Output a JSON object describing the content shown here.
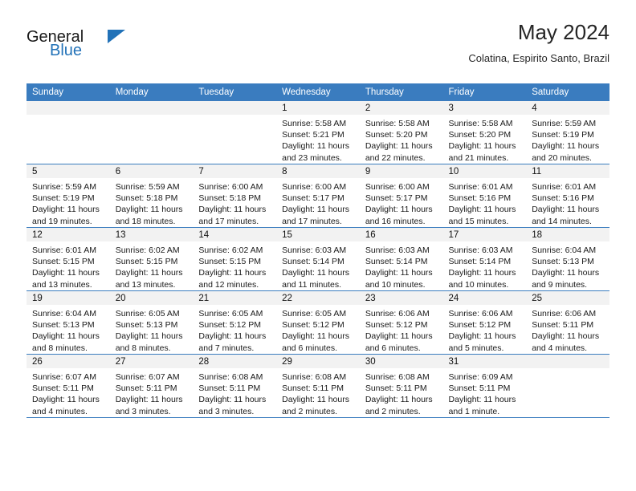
{
  "header": {
    "logo": {
      "word_one": "General",
      "word_two": "Blue",
      "triangle_icon": "triangle-icon",
      "accent_color": "#2272b8"
    },
    "title": "May 2024",
    "subtitle": "Colatina, Espirito Santo, Brazil"
  },
  "calendar": {
    "header_color": "#3a7cbf",
    "weekday_headers": [
      "Sunday",
      "Monday",
      "Tuesday",
      "Wednesday",
      "Thursday",
      "Friday",
      "Saturday"
    ],
    "weeks": [
      [
        {
          "day": "",
          "sunrise": "",
          "sunset": "",
          "daylight_line1": "",
          "daylight_line2": "",
          "empty": true
        },
        {
          "day": "",
          "sunrise": "",
          "sunset": "",
          "daylight_line1": "",
          "daylight_line2": "",
          "empty": true
        },
        {
          "day": "",
          "sunrise": "",
          "sunset": "",
          "daylight_line1": "",
          "daylight_line2": "",
          "empty": true
        },
        {
          "day": "1",
          "sunrise": "Sunrise: 5:58 AM",
          "sunset": "Sunset: 5:21 PM",
          "daylight_line1": "Daylight: 11 hours",
          "daylight_line2": "and 23 minutes."
        },
        {
          "day": "2",
          "sunrise": "Sunrise: 5:58 AM",
          "sunset": "Sunset: 5:20 PM",
          "daylight_line1": "Daylight: 11 hours",
          "daylight_line2": "and 22 minutes."
        },
        {
          "day": "3",
          "sunrise": "Sunrise: 5:58 AM",
          "sunset": "Sunset: 5:20 PM",
          "daylight_line1": "Daylight: 11 hours",
          "daylight_line2": "and 21 minutes."
        },
        {
          "day": "4",
          "sunrise": "Sunrise: 5:59 AM",
          "sunset": "Sunset: 5:19 PM",
          "daylight_line1": "Daylight: 11 hours",
          "daylight_line2": "and 20 minutes."
        }
      ],
      [
        {
          "day": "5",
          "sunrise": "Sunrise: 5:59 AM",
          "sunset": "Sunset: 5:19 PM",
          "daylight_line1": "Daylight: 11 hours",
          "daylight_line2": "and 19 minutes."
        },
        {
          "day": "6",
          "sunrise": "Sunrise: 5:59 AM",
          "sunset": "Sunset: 5:18 PM",
          "daylight_line1": "Daylight: 11 hours",
          "daylight_line2": "and 18 minutes."
        },
        {
          "day": "7",
          "sunrise": "Sunrise: 6:00 AM",
          "sunset": "Sunset: 5:18 PM",
          "daylight_line1": "Daylight: 11 hours",
          "daylight_line2": "and 17 minutes."
        },
        {
          "day": "8",
          "sunrise": "Sunrise: 6:00 AM",
          "sunset": "Sunset: 5:17 PM",
          "daylight_line1": "Daylight: 11 hours",
          "daylight_line2": "and 17 minutes."
        },
        {
          "day": "9",
          "sunrise": "Sunrise: 6:00 AM",
          "sunset": "Sunset: 5:17 PM",
          "daylight_line1": "Daylight: 11 hours",
          "daylight_line2": "and 16 minutes."
        },
        {
          "day": "10",
          "sunrise": "Sunrise: 6:01 AM",
          "sunset": "Sunset: 5:16 PM",
          "daylight_line1": "Daylight: 11 hours",
          "daylight_line2": "and 15 minutes."
        },
        {
          "day": "11",
          "sunrise": "Sunrise: 6:01 AM",
          "sunset": "Sunset: 5:16 PM",
          "daylight_line1": "Daylight: 11 hours",
          "daylight_line2": "and 14 minutes."
        }
      ],
      [
        {
          "day": "12",
          "sunrise": "Sunrise: 6:01 AM",
          "sunset": "Sunset: 5:15 PM",
          "daylight_line1": "Daylight: 11 hours",
          "daylight_line2": "and 13 minutes."
        },
        {
          "day": "13",
          "sunrise": "Sunrise: 6:02 AM",
          "sunset": "Sunset: 5:15 PM",
          "daylight_line1": "Daylight: 11 hours",
          "daylight_line2": "and 13 minutes."
        },
        {
          "day": "14",
          "sunrise": "Sunrise: 6:02 AM",
          "sunset": "Sunset: 5:15 PM",
          "daylight_line1": "Daylight: 11 hours",
          "daylight_line2": "and 12 minutes."
        },
        {
          "day": "15",
          "sunrise": "Sunrise: 6:03 AM",
          "sunset": "Sunset: 5:14 PM",
          "daylight_line1": "Daylight: 11 hours",
          "daylight_line2": "and 11 minutes."
        },
        {
          "day": "16",
          "sunrise": "Sunrise: 6:03 AM",
          "sunset": "Sunset: 5:14 PM",
          "daylight_line1": "Daylight: 11 hours",
          "daylight_line2": "and 10 minutes."
        },
        {
          "day": "17",
          "sunrise": "Sunrise: 6:03 AM",
          "sunset": "Sunset: 5:14 PM",
          "daylight_line1": "Daylight: 11 hours",
          "daylight_line2": "and 10 minutes."
        },
        {
          "day": "18",
          "sunrise": "Sunrise: 6:04 AM",
          "sunset": "Sunset: 5:13 PM",
          "daylight_line1": "Daylight: 11 hours",
          "daylight_line2": "and 9 minutes."
        }
      ],
      [
        {
          "day": "19",
          "sunrise": "Sunrise: 6:04 AM",
          "sunset": "Sunset: 5:13 PM",
          "daylight_line1": "Daylight: 11 hours",
          "daylight_line2": "and 8 minutes."
        },
        {
          "day": "20",
          "sunrise": "Sunrise: 6:05 AM",
          "sunset": "Sunset: 5:13 PM",
          "daylight_line1": "Daylight: 11 hours",
          "daylight_line2": "and 8 minutes."
        },
        {
          "day": "21",
          "sunrise": "Sunrise: 6:05 AM",
          "sunset": "Sunset: 5:12 PM",
          "daylight_line1": "Daylight: 11 hours",
          "daylight_line2": "and 7 minutes."
        },
        {
          "day": "22",
          "sunrise": "Sunrise: 6:05 AM",
          "sunset": "Sunset: 5:12 PM",
          "daylight_line1": "Daylight: 11 hours",
          "daylight_line2": "and 6 minutes."
        },
        {
          "day": "23",
          "sunrise": "Sunrise: 6:06 AM",
          "sunset": "Sunset: 5:12 PM",
          "daylight_line1": "Daylight: 11 hours",
          "daylight_line2": "and 6 minutes."
        },
        {
          "day": "24",
          "sunrise": "Sunrise: 6:06 AM",
          "sunset": "Sunset: 5:12 PM",
          "daylight_line1": "Daylight: 11 hours",
          "daylight_line2": "and 5 minutes."
        },
        {
          "day": "25",
          "sunrise": "Sunrise: 6:06 AM",
          "sunset": "Sunset: 5:11 PM",
          "daylight_line1": "Daylight: 11 hours",
          "daylight_line2": "and 4 minutes."
        }
      ],
      [
        {
          "day": "26",
          "sunrise": "Sunrise: 6:07 AM",
          "sunset": "Sunset: 5:11 PM",
          "daylight_line1": "Daylight: 11 hours",
          "daylight_line2": "and 4 minutes."
        },
        {
          "day": "27",
          "sunrise": "Sunrise: 6:07 AM",
          "sunset": "Sunset: 5:11 PM",
          "daylight_line1": "Daylight: 11 hours",
          "daylight_line2": "and 3 minutes."
        },
        {
          "day": "28",
          "sunrise": "Sunrise: 6:08 AM",
          "sunset": "Sunset: 5:11 PM",
          "daylight_line1": "Daylight: 11 hours",
          "daylight_line2": "and 3 minutes."
        },
        {
          "day": "29",
          "sunrise": "Sunrise: 6:08 AM",
          "sunset": "Sunset: 5:11 PM",
          "daylight_line1": "Daylight: 11 hours",
          "daylight_line2": "and 2 minutes."
        },
        {
          "day": "30",
          "sunrise": "Sunrise: 6:08 AM",
          "sunset": "Sunset: 5:11 PM",
          "daylight_line1": "Daylight: 11 hours",
          "daylight_line2": "and 2 minutes."
        },
        {
          "day": "31",
          "sunrise": "Sunrise: 6:09 AM",
          "sunset": "Sunset: 5:11 PM",
          "daylight_line1": "Daylight: 11 hours",
          "daylight_line2": "and 1 minute."
        },
        {
          "day": "",
          "sunrise": "",
          "sunset": "",
          "daylight_line1": "",
          "daylight_line2": "",
          "empty": true
        }
      ]
    ]
  }
}
